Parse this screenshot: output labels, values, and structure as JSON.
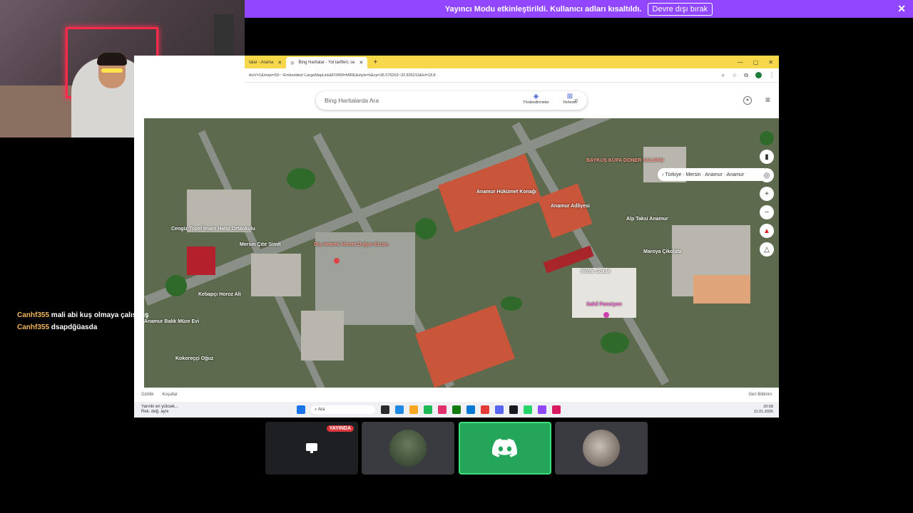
{
  "banner": {
    "message": "Yayıncı Modu etkinleştirildi. Kullanıcı adları kısaltıldı.",
    "disable_label": "Devre dışı bırak",
    "close_icon": "close-icon",
    "background": "#9146ff"
  },
  "browser": {
    "tabs": [
      {
        "label": "talar - Arama",
        "active": false
      },
      {
        "label": "Bing Haritalar - Yol tarifleri, se",
        "active": true
      }
    ],
    "url": "tksV=1&mepi=59~~Embedded~LargeMapLink&FORM=MIRE&style=h&cp=36.076263~32.836219&lvl=18.8"
  },
  "bing": {
    "search_placeholder": "Bing Haritalarda Ara",
    "nav": [
      {
        "label": "Yönlendirmeler",
        "icon": "directions-icon"
      },
      {
        "label": "Yerlerim",
        "icon": "places-icon"
      }
    ]
  },
  "map": {
    "breadcrumb": "Türkiye · Mersin · Anamur · Anamur",
    "pois": [
      {
        "label": "Cengiz Topel İmam Hatip Ortaokulu"
      },
      {
        "label": "Mersin Çıtır Simit"
      },
      {
        "label": "Diş Hekimi Ahmet Doğan Ercan"
      },
      {
        "label": "Kebapçı Horoz Ali"
      },
      {
        "label": "Anamur Balık Müze Evi"
      },
      {
        "label": "Kokoreççi Oğuz"
      },
      {
        "label": "Anamur Hükümet Konağı"
      },
      {
        "label": "Anamur Adliyesi"
      },
      {
        "label": "BAYKUŞ KÜPA DÖNER SALONU"
      },
      {
        "label": "Alp Taksi Anamur"
      },
      {
        "label": "Maroya Çikolata"
      },
      {
        "label": "Sahil Pansiyon"
      },
      {
        "label": "Nilüfe Sokak"
      }
    ]
  },
  "map_footer": {
    "privacy": "Gizlilik",
    "terms": "Koşullar",
    "feedback": "Geri Bildirim"
  },
  "taskbar": {
    "weather": "Yarınki en yüksek...",
    "weather_sub": "Rek. değ. aynı",
    "search": "Ara",
    "time": "20:58",
    "date": "11.01.2026"
  },
  "chat": [
    {
      "user": "Canhf355",
      "message": "mali abi kuş olmaya çalışmış"
    },
    {
      "user": "Canhf355",
      "message": "dsapdğüasda"
    }
  ],
  "voice": {
    "live_label": "YAYINDA"
  }
}
